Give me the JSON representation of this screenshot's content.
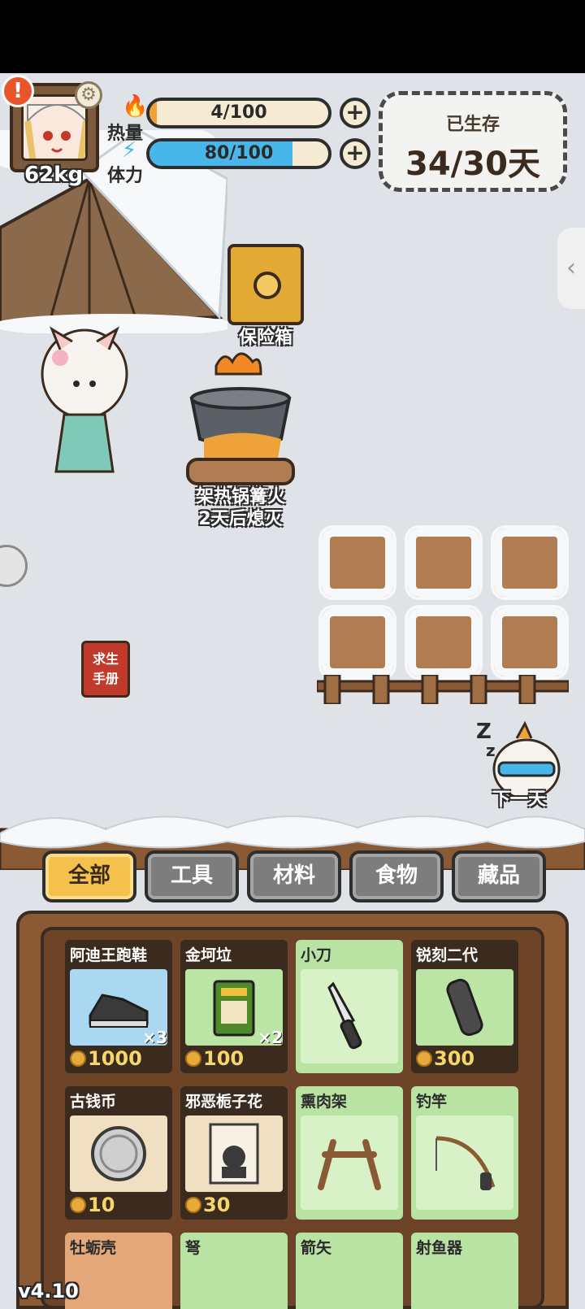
{
  "player": {
    "weight": "62kg"
  },
  "stats": {
    "heat": {
      "label": "热量",
      "value": "4/100",
      "fraction": 0.04,
      "color": "#f0a23a"
    },
    "stamina": {
      "label": "体力",
      "value": "80/100",
      "fraction": 0.8,
      "color": "#48b6e8"
    }
  },
  "survival": {
    "label": "已生存",
    "value": "34/30天"
  },
  "world": {
    "safe_label": "保险箱",
    "campfire_title": "架热锅篝火",
    "campfire_status": "2天后熄灭",
    "manual_line1": "求生",
    "manual_line2": "手册",
    "next_day_label": "下一天"
  },
  "tabs": [
    "全部",
    "工具",
    "材料",
    "食物",
    "藏品"
  ],
  "active_tab": "全部",
  "items": [
    {
      "name": "阿迪王跑鞋",
      "qty": "×3",
      "price": "1000",
      "icon": "sneaker-icon"
    },
    {
      "name": "金坷垃",
      "qty": "×2",
      "price": "100",
      "icon": "fertilizer-bag-icon"
    },
    {
      "name": "小刀",
      "qty": "",
      "price": "",
      "icon": "knife-icon"
    },
    {
      "name": "锐刻二代",
      "qty": "",
      "price": "300",
      "icon": "e-cigarette-icon"
    },
    {
      "name": "古钱币",
      "qty": "",
      "price": "10",
      "icon": "coin-icon"
    },
    {
      "name": "邪恶栀子花",
      "qty": "",
      "price": "30",
      "icon": "book-icon"
    },
    {
      "name": "熏肉架",
      "qty": "",
      "price": "",
      "icon": "rack-icon"
    },
    {
      "name": "钓竿",
      "qty": "",
      "price": "",
      "icon": "fishing-rod-icon"
    },
    {
      "name": "牡蛎壳",
      "qty": "",
      "price": "",
      "icon": "shell-icon"
    },
    {
      "name": "弩",
      "qty": "",
      "price": "",
      "icon": "crossbow-icon"
    },
    {
      "name": "箭矢",
      "qty": "",
      "price": "",
      "icon": "arrow-icon"
    },
    {
      "name": "射鱼器",
      "qty": "",
      "price": "",
      "icon": "spear-icon"
    }
  ],
  "version": "v4.10"
}
